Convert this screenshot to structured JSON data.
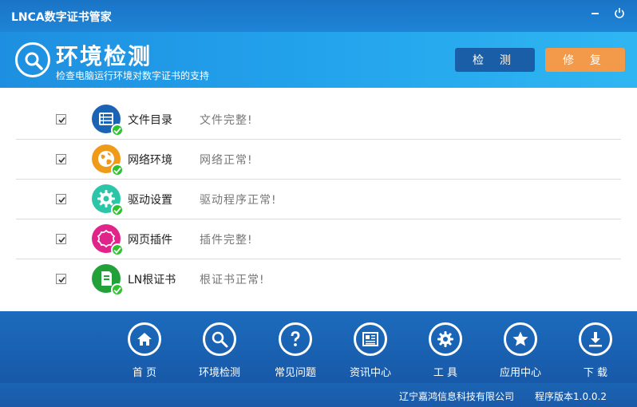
{
  "window": {
    "title": "LNCA数字证书管家"
  },
  "header": {
    "title": "环境检测",
    "subtitle": "检查电脑运行环境对数字证书的支持",
    "detect_label": "检 测",
    "repair_label": "修 复"
  },
  "checks": [
    {
      "name": "文件目录",
      "status": "文件完整!",
      "icon": "list-icon",
      "color": "#1a63b5"
    },
    {
      "name": "网络环境",
      "status": "网络正常!",
      "icon": "globe-icon",
      "color": "#f09a1a"
    },
    {
      "name": "驱动设置",
      "status": "驱动程序正常!",
      "icon": "gear-icon",
      "color": "#2bc6a8"
    },
    {
      "name": "网页插件",
      "status": "插件完整!",
      "icon": "flower-icon",
      "color": "#e0248a"
    },
    {
      "name": "LN根证书",
      "status": "根证书正常!",
      "icon": "document-icon",
      "color": "#22a03a"
    }
  ],
  "nav": [
    {
      "label": "首 页",
      "icon": "home-icon"
    },
    {
      "label": "环境检测",
      "icon": "search-icon"
    },
    {
      "label": "常见问题",
      "icon": "question-icon"
    },
    {
      "label": "资讯中心",
      "icon": "news-icon"
    },
    {
      "label": "工 具",
      "icon": "gear-icon"
    },
    {
      "label": "应用中心",
      "icon": "star-icon"
    },
    {
      "label": "下 载",
      "icon": "download-icon"
    }
  ],
  "status": {
    "company": "辽宁嘉鸿信息科技有限公司",
    "version": "程序版本1.0.0.2"
  }
}
